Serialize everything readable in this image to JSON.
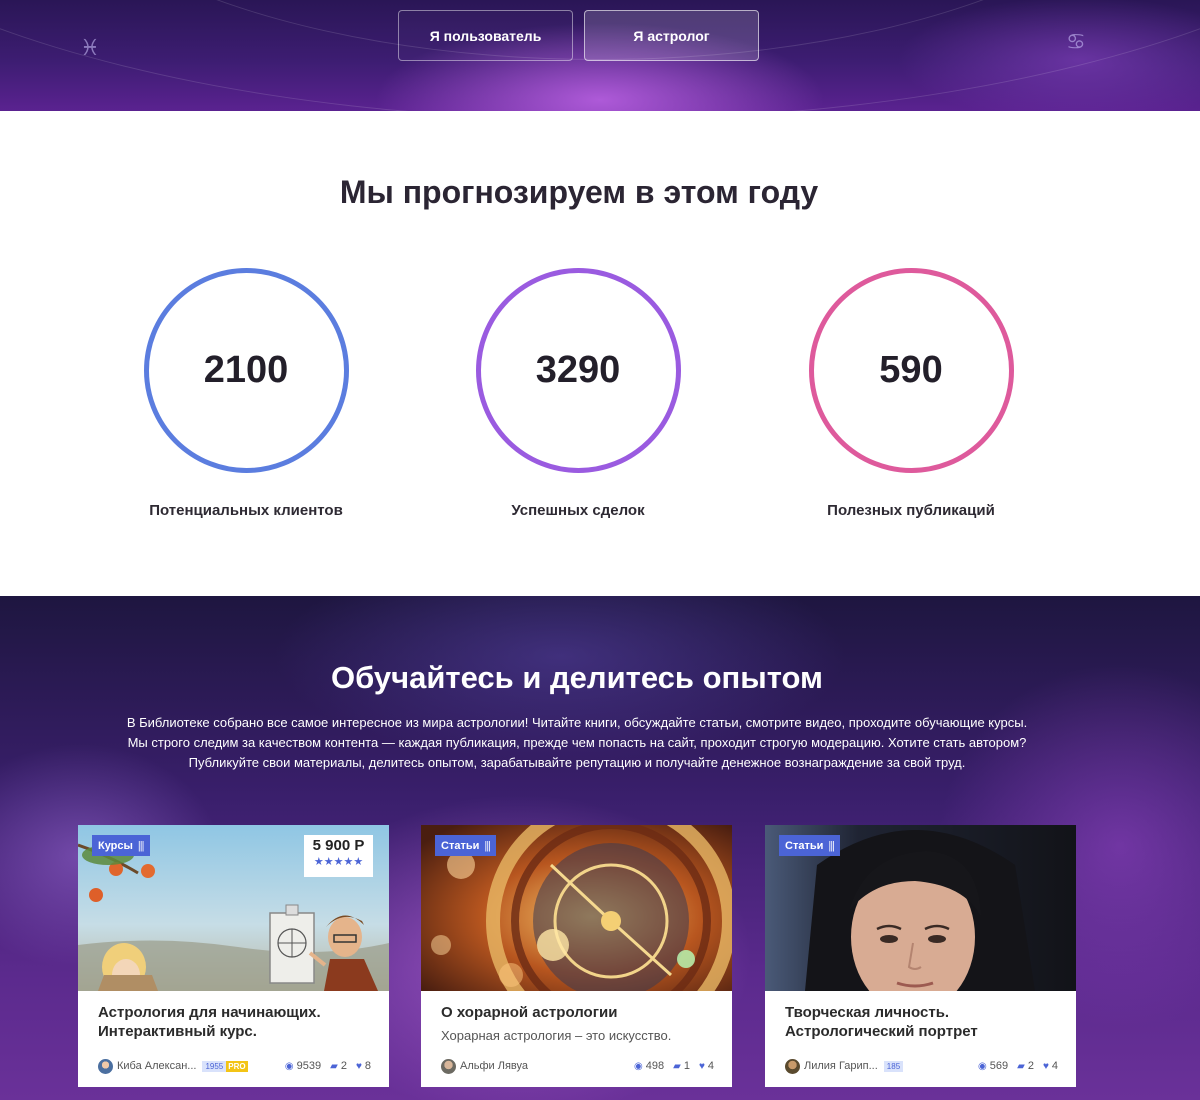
{
  "role_switch": {
    "user_label": "Я пользователь",
    "astrologer_label": "Я астролог",
    "active": "astrologer"
  },
  "forecast": {
    "title": "Мы прогнозируем в этом году",
    "items": [
      {
        "value": "2100",
        "label": "Потенциальных клиентов",
        "color": "#5b7ddf"
      },
      {
        "value": "3290",
        "label": "Успешных сделок",
        "color": "#9a5be0"
      },
      {
        "value": "590",
        "label": "Полезных публикаций",
        "color": "#de5a9c"
      }
    ]
  },
  "library": {
    "title": "Обучайтесь и делитесь опытом",
    "intro_lines": [
      "В Библиотеке собрано все самое интересное из мира астрологии! Читайте книги, обсуждайте статьи, смотрите видео, проходите обучающие курсы.",
      "Мы строго следим за качеством контента — каждая публикация, прежде чем попасть на сайт, проходит строгую модерацию. Хотите стать автором?",
      "Публикуйте свои материалы, делитесь опытом, зарабатывайте репутацию и получайте денежное вознаграждение за свой труд."
    ],
    "cards": [
      {
        "tag": "Курсы",
        "price": "5 900 Р",
        "rating_stars": 5,
        "title": "Астрология для начинающих. Интерактивный курс.",
        "excerpt": "",
        "author": "Киба Алексан...",
        "reputation": "1955",
        "pro": "PRO",
        "views": "9539",
        "comments": "2",
        "likes": "8"
      },
      {
        "tag": "Статьи",
        "title": "О хорарной астрологии",
        "excerpt": "Хорарная астрология – это искусство.",
        "author": "Альфи Лявуа",
        "views": "498",
        "comments": "1",
        "likes": "4"
      },
      {
        "tag": "Статьи",
        "title": "Творческая личность. Астрологический портрет",
        "excerpt": "",
        "author": "Лилия Гарип...",
        "reputation": "185",
        "views": "569",
        "comments": "2",
        "likes": "4"
      }
    ]
  },
  "icons": {
    "zodiac_left": "pisces-icon",
    "zodiac_right": "cancer-icon",
    "views": "eye-icon",
    "comments": "comment-icon",
    "likes": "heart-icon",
    "rating": "star-icon"
  },
  "colors": {
    "accent_blue": "#4b64d6",
    "pro_badge": "#f3c416"
  }
}
